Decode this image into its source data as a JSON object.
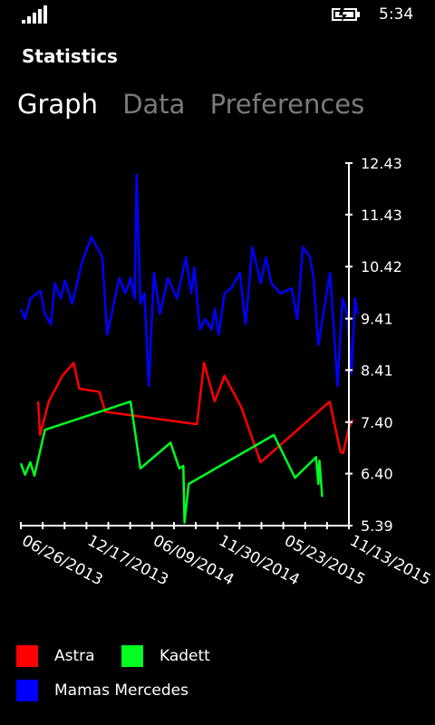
{
  "status": {
    "time": "5:34"
  },
  "app": {
    "title": "Statistics"
  },
  "pivot": {
    "tabs": [
      "Graph",
      "Data",
      "Preferences"
    ],
    "active": 0
  },
  "chart_data": {
    "type": "line",
    "x_ticks": [
      "06/26/2013",
      "12/17/2013",
      "06/09/2014",
      "11/30/2014",
      "05/23/2015",
      "11/13/2015"
    ],
    "y_ticks": [
      "12.43",
      "11.43",
      "10.42",
      "9.41",
      "8.41",
      "7.40",
      "6.40",
      "5.39"
    ],
    "ylim": [
      5.39,
      12.43
    ],
    "grid": false,
    "legend_position": "bottom",
    "series": [
      {
        "name": "Astra",
        "color": "#ff0000",
        "points": [
          [
            "2013-08-11",
            7.8
          ],
          [
            "2013-08-16",
            7.15
          ],
          [
            "2013-09-08",
            7.8
          ],
          [
            "2013-10-14",
            8.3
          ],
          [
            "2013-11-13",
            8.55
          ],
          [
            "2013-11-28",
            8.05
          ],
          [
            "2014-01-20",
            7.99
          ],
          [
            "2014-02-05",
            7.6
          ],
          [
            "2014-10-06",
            7.36
          ],
          [
            "2014-10-25",
            8.55
          ],
          [
            "2014-11-22",
            7.8
          ],
          [
            "2014-12-18",
            8.3
          ],
          [
            "2015-01-31",
            7.7
          ],
          [
            "2015-03-24",
            6.62
          ],
          [
            "2015-09-23",
            7.8
          ],
          [
            "2015-10-22",
            6.82
          ],
          [
            "2015-10-29",
            6.8
          ],
          [
            "2015-11-13",
            7.3
          ],
          [
            "2015-11-23",
            7.45
          ]
        ]
      },
      {
        "name": "Kadett",
        "color": "#00ff21",
        "points": [
          [
            "2013-06-26",
            6.6
          ],
          [
            "2013-07-07",
            6.38
          ],
          [
            "2013-07-21",
            6.62
          ],
          [
            "2013-08-01",
            6.36
          ],
          [
            "2013-08-29",
            7.25
          ],
          [
            "2014-04-13",
            7.8
          ],
          [
            "2014-05-09",
            6.5
          ],
          [
            "2014-07-28",
            7.0
          ],
          [
            "2014-08-20",
            6.5
          ],
          [
            "2014-08-31",
            6.55
          ],
          [
            "2014-09-03",
            5.45
          ],
          [
            "2014-09-14",
            6.2
          ],
          [
            "2015-04-28",
            7.15
          ],
          [
            "2015-06-23",
            6.32
          ],
          [
            "2015-08-18",
            6.72
          ],
          [
            "2015-08-24",
            6.2
          ],
          [
            "2015-08-27",
            6.65
          ],
          [
            "2015-09-03",
            5.95
          ]
        ]
      },
      {
        "name": "Mamas Mercedes",
        "color": "#0000ff",
        "points": [
          [
            "2013-06-26",
            9.6
          ],
          [
            "2013-07-07",
            9.4
          ],
          [
            "2013-07-21",
            9.8
          ],
          [
            "2013-08-17",
            9.95
          ],
          [
            "2013-08-29",
            9.5
          ],
          [
            "2013-09-14",
            9.3
          ],
          [
            "2013-09-24",
            10.1
          ],
          [
            "2013-10-10",
            9.8
          ],
          [
            "2013-10-21",
            10.15
          ],
          [
            "2013-11-09",
            9.7
          ],
          [
            "2013-12-05",
            10.5
          ],
          [
            "2013-12-30",
            11.0
          ],
          [
            "2014-01-28",
            10.6
          ],
          [
            "2014-02-10",
            9.1
          ],
          [
            "2014-03-14",
            10.2
          ],
          [
            "2014-03-30",
            9.9
          ],
          [
            "2014-04-13",
            10.2
          ],
          [
            "2014-04-24",
            9.8
          ],
          [
            "2014-04-29",
            12.2
          ],
          [
            "2014-05-09",
            9.7
          ],
          [
            "2014-05-20",
            9.9
          ],
          [
            "2014-05-31",
            8.1
          ],
          [
            "2014-06-14",
            10.3
          ],
          [
            "2014-06-30",
            9.5
          ],
          [
            "2014-07-21",
            10.2
          ],
          [
            "2014-08-14",
            9.8
          ],
          [
            "2014-09-07",
            10.6
          ],
          [
            "2014-09-21",
            9.9
          ],
          [
            "2014-09-29",
            10.4
          ],
          [
            "2014-10-14",
            9.2
          ],
          [
            "2014-10-28",
            9.4
          ],
          [
            "2014-11-14",
            9.2
          ],
          [
            "2014-11-22",
            9.6
          ],
          [
            "2014-12-03",
            9.1
          ],
          [
            "2014-12-18",
            9.9
          ],
          [
            "2015-01-05",
            10.0
          ],
          [
            "2015-01-28",
            10.3
          ],
          [
            "2015-02-12",
            9.3
          ],
          [
            "2015-03-02",
            10.8
          ],
          [
            "2015-03-24",
            10.1
          ],
          [
            "2015-04-07",
            10.6
          ],
          [
            "2015-04-21",
            10.1
          ],
          [
            "2015-05-15",
            9.9
          ],
          [
            "2015-06-14",
            10.0
          ],
          [
            "2015-06-29",
            9.4
          ],
          [
            "2015-07-14",
            10.8
          ],
          [
            "2015-08-02",
            10.6
          ],
          [
            "2015-08-11",
            10.2
          ],
          [
            "2015-08-24",
            8.9
          ],
          [
            "2015-09-15",
            9.9
          ],
          [
            "2015-09-24",
            10.3
          ],
          [
            "2015-10-03",
            9.3
          ],
          [
            "2015-10-14",
            8.1
          ],
          [
            "2015-10-27",
            9.8
          ],
          [
            "2015-11-09",
            9.5
          ],
          [
            "2015-11-20",
            8.35
          ],
          [
            "2015-11-29",
            9.8
          ],
          [
            "2015-12-06",
            9.5
          ]
        ]
      }
    ]
  },
  "legend": [
    {
      "label": "Astra",
      "color": "#ff0000"
    },
    {
      "label": "Kadett",
      "color": "#00ff21"
    },
    {
      "label": "Mamas Mercedes",
      "color": "#0000ff"
    }
  ]
}
